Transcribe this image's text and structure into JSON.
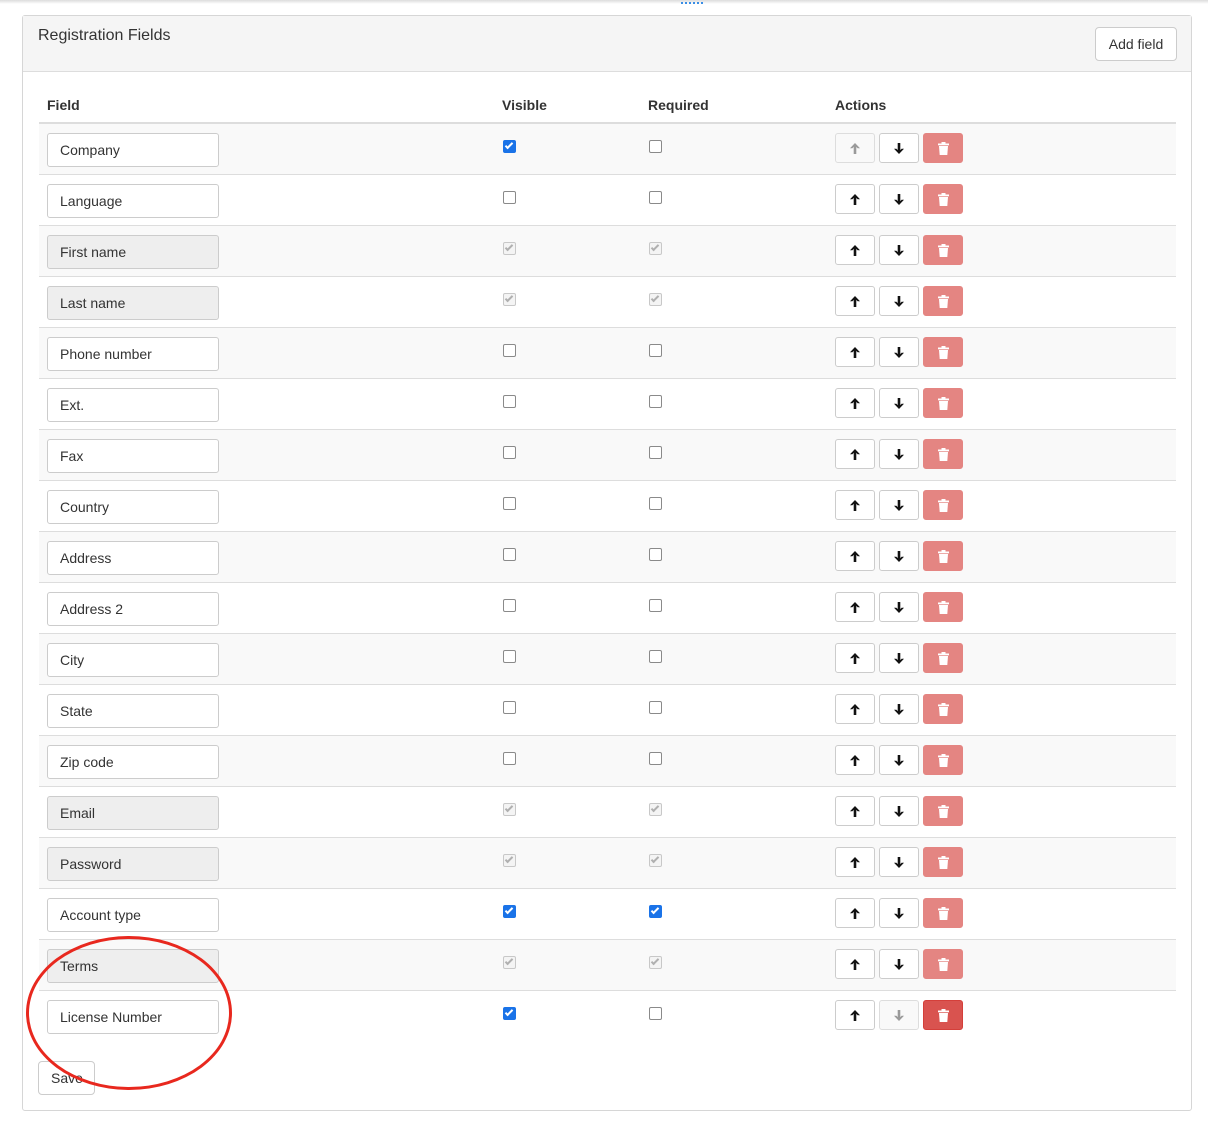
{
  "panel": {
    "title": "Registration Fields",
    "add_field_label": "Add field",
    "save_label": "Save"
  },
  "columns": {
    "field": "Field",
    "visible": "Visible",
    "required": "Required",
    "actions": "Actions"
  },
  "rows": [
    {
      "label": "Company",
      "readonly": false,
      "visible": true,
      "required": false,
      "locked": false
    },
    {
      "label": "Language",
      "readonly": false,
      "visible": false,
      "required": false,
      "locked": false
    },
    {
      "label": "First name",
      "readonly": true,
      "visible": true,
      "required": true,
      "locked": true
    },
    {
      "label": "Last name",
      "readonly": true,
      "visible": true,
      "required": true,
      "locked": true
    },
    {
      "label": "Phone number",
      "readonly": false,
      "visible": false,
      "required": false,
      "locked": false
    },
    {
      "label": "Ext.",
      "readonly": false,
      "visible": false,
      "required": false,
      "locked": false
    },
    {
      "label": "Fax",
      "readonly": false,
      "visible": false,
      "required": false,
      "locked": false
    },
    {
      "label": "Country",
      "readonly": false,
      "visible": false,
      "required": false,
      "locked": false
    },
    {
      "label": "Address",
      "readonly": false,
      "visible": false,
      "required": false,
      "locked": false
    },
    {
      "label": "Address 2",
      "readonly": false,
      "visible": false,
      "required": false,
      "locked": false
    },
    {
      "label": "City",
      "readonly": false,
      "visible": false,
      "required": false,
      "locked": false
    },
    {
      "label": "State",
      "readonly": false,
      "visible": false,
      "required": false,
      "locked": false
    },
    {
      "label": "Zip code",
      "readonly": false,
      "visible": false,
      "required": false,
      "locked": false
    },
    {
      "label": "Email",
      "readonly": true,
      "visible": true,
      "required": true,
      "locked": true
    },
    {
      "label": "Password",
      "readonly": true,
      "visible": true,
      "required": true,
      "locked": true
    },
    {
      "label": "Account type",
      "readonly": false,
      "visible": true,
      "required": true,
      "locked": false
    },
    {
      "label": "Terms",
      "readonly": true,
      "visible": true,
      "required": true,
      "locked": true
    },
    {
      "label": "License Number",
      "readonly": false,
      "visible": true,
      "required": false,
      "locked": false
    }
  ],
  "colors": {
    "checkbox_checked": "#1a73e8",
    "delete_faded": "#e48582",
    "delete_active": "#d9534f",
    "annotation": "#e8281e"
  },
  "icons": {
    "up": "arrow-up-icon",
    "down": "arrow-down-icon",
    "delete": "trash-icon"
  }
}
